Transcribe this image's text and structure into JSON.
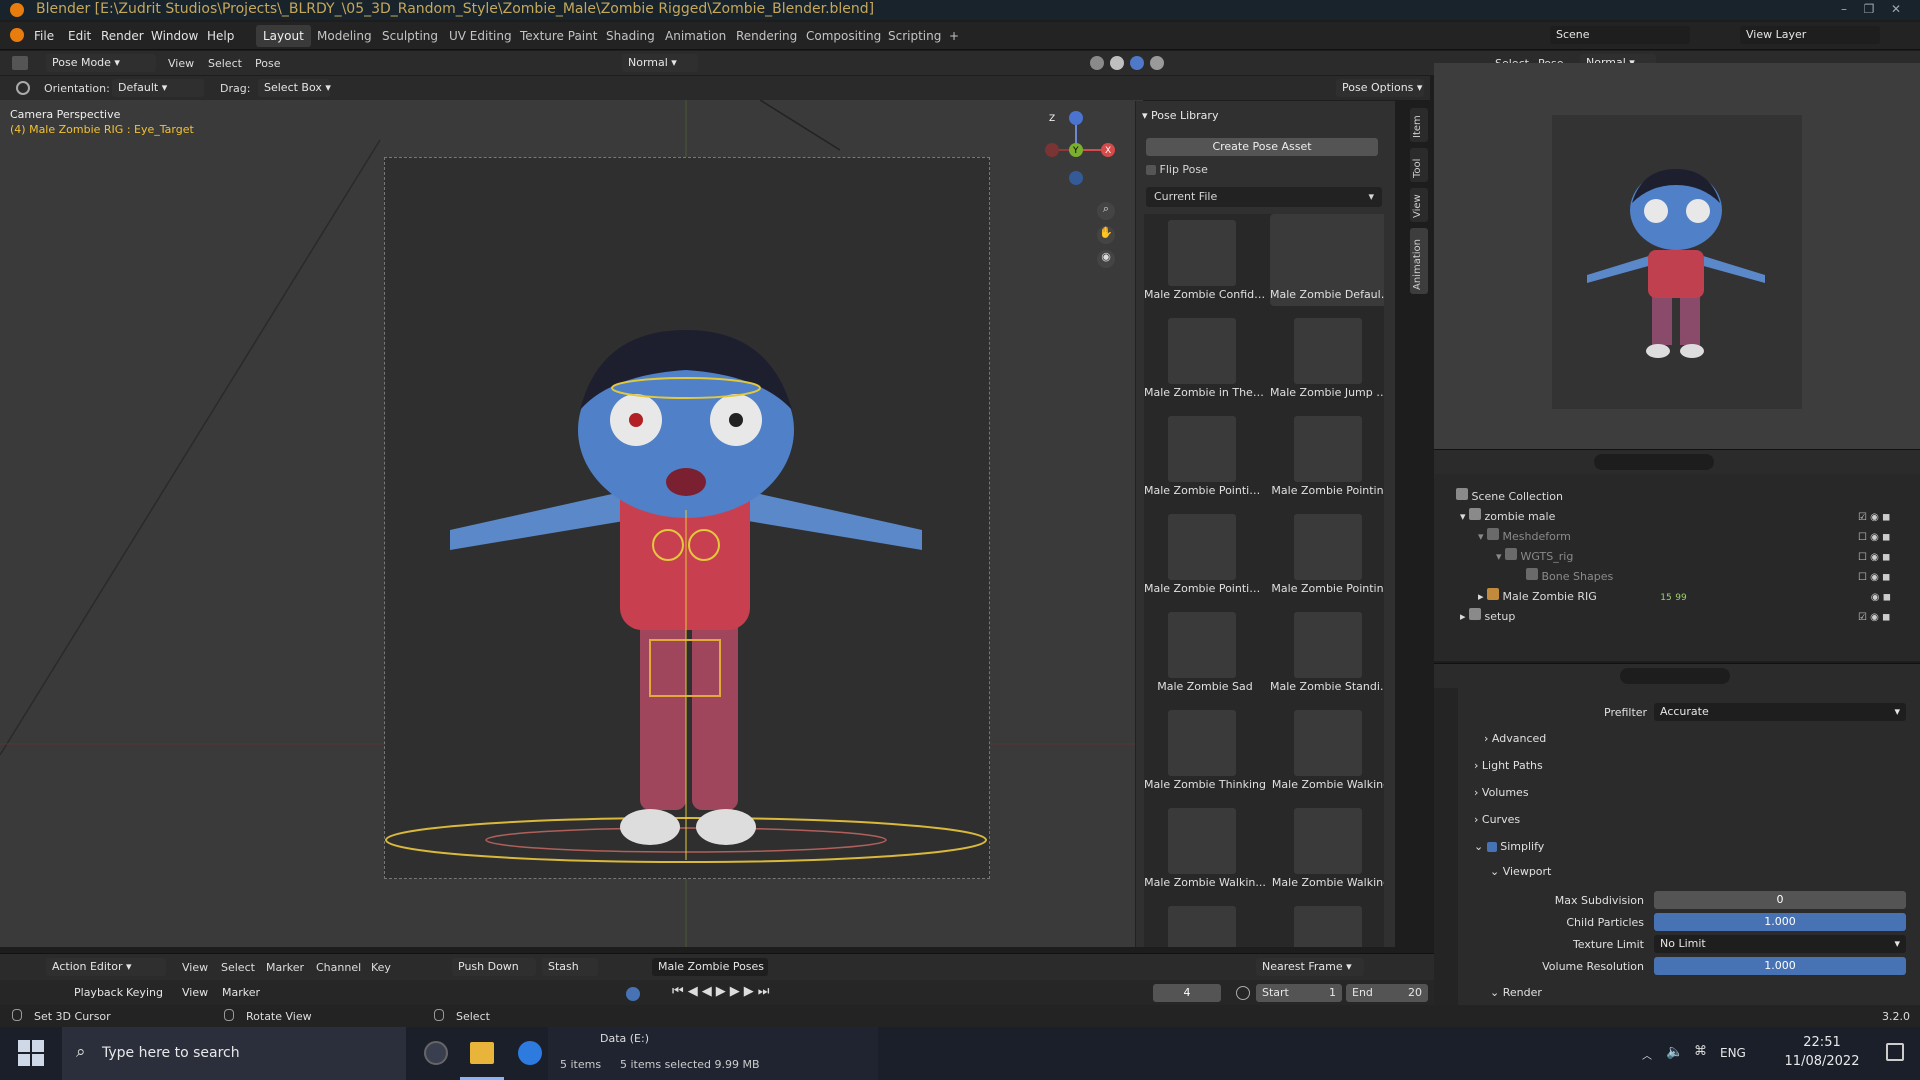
{
  "window": {
    "title": "Blender [E:\\Zudrit Studios\\Projects\\_BLRDY_\\05_3D_Random_Style\\Zombie_Male\\Zombie Rigged\\Zombie_Blender.blend]"
  },
  "menus": [
    "File",
    "Edit",
    "Render",
    "Window",
    "Help"
  ],
  "workspaces": [
    "Layout",
    "Modeling",
    "Sculpting",
    "UV Editing",
    "Texture Paint",
    "Shading",
    "Animation",
    "Rendering",
    "Compositing",
    "Scripting",
    "+"
  ],
  "active_workspace": "Layout",
  "scene": {
    "name": "Scene",
    "view_layer": "View Layer"
  },
  "viewport_header": {
    "mode": "Pose Mode",
    "menus": [
      "View",
      "Select",
      "Pose"
    ],
    "transform": "Normal",
    "orientation_label": "Orientation:",
    "orientation": "Default",
    "drag_label": "Drag:",
    "drag": "Select Box",
    "pose_options": "Pose Options"
  },
  "viewport": {
    "camera_label": "Camera Perspective",
    "object_label": "(4) Male Zombie RIG : Eye_Target"
  },
  "gizmo": {
    "x": "X",
    "y": "Y",
    "z": "Z"
  },
  "pose_library": {
    "title": "Pose Library",
    "create_button": "Create Pose Asset",
    "flip_pose": "Flip Pose",
    "library": "Current File",
    "poses": [
      "Male Zombie Confiden",
      "Male Zombie Default ...",
      "Male Zombie in The ai",
      "Male Zombie Jump H...",
      "Male Zombie Pointin...",
      "Male Zombie Pointing",
      "Male Zombie Pointin...",
      "Male Zombie Pointing",
      "Male Zombie Sad",
      "Male Zombie Standin...",
      "Male Zombie Thinking",
      "Male Zombie Walking",
      "Male Zombie Walkin...",
      "Male Zombie Walking"
    ]
  },
  "side_tabs": [
    "Item",
    "Tool",
    "View",
    "Animation"
  ],
  "right_header": {
    "menus": [
      "Select",
      "Pose"
    ],
    "transform": "Normal"
  },
  "outliner": {
    "rows": [
      {
        "label": "Scene Collection",
        "indent": 0
      },
      {
        "label": "zombie male",
        "indent": 1
      },
      {
        "label": "Meshdeform",
        "indent": 2
      },
      {
        "label": "WGTS_rig",
        "indent": 3
      },
      {
        "label": "Bone Shapes",
        "indent": 4
      },
      {
        "label": "Male Zombie RIG",
        "indent": 2
      },
      {
        "label": "setup",
        "indent": 1
      }
    ],
    "rig_badges": [
      "15",
      "99"
    ]
  },
  "properties": {
    "prefilter_label": "Prefilter",
    "prefilter": "Accurate",
    "sections": [
      "Advanced",
      "Light Paths",
      "Volumes",
      "Curves"
    ],
    "simplify": "Simplify",
    "viewport_label": "Viewport",
    "fields": [
      {
        "label": "Max Subdivision",
        "value": "0"
      },
      {
        "label": "Child Particles",
        "value": "1.000"
      },
      {
        "label": "Texture Limit",
        "value": "No Limit"
      },
      {
        "label": "Volume Resolution",
        "value": "1.000"
      }
    ],
    "render_label": "Render",
    "version": "3.2.0"
  },
  "action_editor": {
    "mode": "Action Editor",
    "menus": [
      "View",
      "Select",
      "Marker",
      "Channel",
      "Key"
    ],
    "push_down": "Push Down",
    "stash": "Stash",
    "action": "Male Zombie Poses",
    "snapping": "Nearest Frame"
  },
  "timeline": {
    "menus": [
      "Playback",
      "Keying",
      "View",
      "Marker"
    ],
    "current_frame": "4",
    "start_label": "Start",
    "start": "1",
    "end_label": "End",
    "end": "20"
  },
  "status_bar": {
    "items": [
      "Set 3D Cursor",
      "Rotate View",
      "Select"
    ]
  },
  "explorer_snippet": {
    "drive": "Data (E:)",
    "count": "5 items",
    "selected": "5 items selected  9.99 MB"
  },
  "taskbar": {
    "search_placeholder": "Type here to search",
    "lang": "ENG",
    "time": "22:51",
    "date": "11/08/2022"
  }
}
